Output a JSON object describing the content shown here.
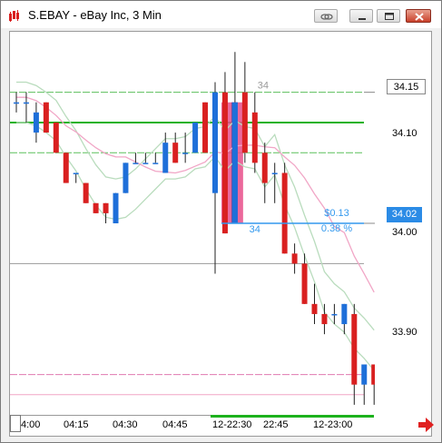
{
  "window": {
    "title": "S.EBAY - eBay Inc, 3 Min"
  },
  "toolbar": {
    "link_icon": "link-icon",
    "minimize_icon": "minimize-icon",
    "maximize_icon": "maximize-icon",
    "close_icon": "close-icon"
  },
  "colors": {
    "up_candle": "#1e6fd9",
    "down_candle": "#d92020",
    "green_line": "#1db21d",
    "ma_green": "#b9dcbd",
    "ma_pink": "#f1a6c6",
    "measure_blue": "#3399ee",
    "highlight_pink": "#e84e8a",
    "highlight_purple": "#6a4c9c"
  },
  "price_axis": {
    "labels": [
      "34.10",
      "34.00",
      "33.90"
    ],
    "current_price_label": "34.15",
    "measure_price_label": "34.02"
  },
  "time_axis": {
    "labels": [
      "4:00",
      "04:15",
      "04:30",
      "04:45",
      "12-22:30",
      "22:45",
      "12-23:00"
    ]
  },
  "measurement": {
    "amount": "$0.13",
    "percent": "0.38 %",
    "bars_top": "34",
    "bars_bottom": "34"
  },
  "chart_data": {
    "type": "candlestick",
    "symbol": "S.EBAY",
    "interval": "3 Min",
    "ylim": [
      33.83,
      34.21
    ],
    "candles": [
      {
        "o": 34.14,
        "h": 34.15,
        "l": 34.13,
        "c": 34.14
      },
      {
        "o": 34.14,
        "h": 34.15,
        "l": 34.12,
        "c": 34.14
      },
      {
        "o": 34.11,
        "h": 34.14,
        "l": 34.1,
        "c": 34.13
      },
      {
        "o": 34.14,
        "h": 34.14,
        "l": 34.11,
        "c": 34.11
      },
      {
        "o": 34.12,
        "h": 34.12,
        "l": 34.09,
        "c": 34.09
      },
      {
        "o": 34.09,
        "h": 34.09,
        "l": 34.06,
        "c": 34.06
      },
      {
        "o": 34.07,
        "h": 34.07,
        "l": 34.06,
        "c": 34.07
      },
      {
        "o": 34.06,
        "h": 34.06,
        "l": 34.04,
        "c": 34.04
      },
      {
        "o": 34.04,
        "h": 34.04,
        "l": 34.03,
        "c": 34.03
      },
      {
        "o": 34.04,
        "h": 34.04,
        "l": 34.02,
        "c": 34.03
      },
      {
        "o": 34.02,
        "h": 34.05,
        "l": 34.02,
        "c": 34.05
      },
      {
        "o": 34.05,
        "h": 34.08,
        "l": 34.05,
        "c": 34.08
      },
      {
        "o": 34.08,
        "h": 34.09,
        "l": 34.08,
        "c": 34.08
      },
      {
        "o": 34.08,
        "h": 34.09,
        "l": 34.08,
        "c": 34.08
      },
      {
        "o": 34.08,
        "h": 34.09,
        "l": 34.08,
        "c": 34.08
      },
      {
        "o": 34.07,
        "h": 34.11,
        "l": 34.07,
        "c": 34.1
      },
      {
        "o": 34.1,
        "h": 34.11,
        "l": 34.08,
        "c": 34.08
      },
      {
        "o": 34.09,
        "h": 34.11,
        "l": 34.08,
        "c": 34.09
      },
      {
        "o": 34.09,
        "h": 34.12,
        "l": 34.09,
        "c": 34.12
      },
      {
        "o": 34.14,
        "h": 34.14,
        "l": 34.09,
        "c": 34.09
      },
      {
        "o": 34.05,
        "h": 34.16,
        "l": 33.97,
        "c": 34.15
      },
      {
        "o": 34.15,
        "h": 34.17,
        "l": 34.01,
        "c": 34.01
      },
      {
        "o": 34.02,
        "h": 34.19,
        "l": 34.02,
        "c": 34.14
      },
      {
        "o": 34.15,
        "h": 34.18,
        "l": 34.08,
        "c": 34.09
      },
      {
        "o": 34.13,
        "h": 34.15,
        "l": 34.07,
        "c": 34.08
      },
      {
        "o": 34.09,
        "h": 34.1,
        "l": 34.04,
        "c": 34.06
      },
      {
        "o": 34.07,
        "h": 34.08,
        "l": 34.04,
        "c": 34.07
      },
      {
        "o": 34.07,
        "h": 34.08,
        "l": 33.99,
        "c": 33.99
      },
      {
        "o": 33.99,
        "h": 34.0,
        "l": 33.97,
        "c": 33.98
      },
      {
        "o": 33.98,
        "h": 33.99,
        "l": 33.94,
        "c": 33.94
      },
      {
        "o": 33.94,
        "h": 33.96,
        "l": 33.92,
        "c": 33.93
      },
      {
        "o": 33.93,
        "h": 33.94,
        "l": 33.91,
        "c": 33.92
      },
      {
        "o": 33.93,
        "h": 33.94,
        "l": 33.92,
        "c": 33.93
      },
      {
        "o": 33.92,
        "h": 33.94,
        "l": 33.91,
        "c": 33.94
      },
      {
        "o": 33.93,
        "h": 33.94,
        "l": 33.84,
        "c": 33.86
      },
      {
        "o": 33.86,
        "h": 33.88,
        "l": 33.84,
        "c": 33.88
      },
      {
        "o": 33.88,
        "h": 33.88,
        "l": 33.84,
        "c": 33.86
      }
    ],
    "horizontal_lines": [
      {
        "price": 34.15,
        "color": "#5cbf5c",
        "style": "dashed"
      },
      {
        "price": 34.12,
        "color": "#1db21d",
        "style": "solid"
      },
      {
        "price": 34.09,
        "color": "#5cbf5c",
        "style": "dashed"
      },
      {
        "price": 33.98,
        "color": "#999999",
        "style": "solid"
      },
      {
        "price": 33.87,
        "color": "#e07ab0",
        "style": "dashed"
      },
      {
        "price": 33.85,
        "color": "#f1a6c6",
        "style": "solid"
      }
    ],
    "price_markers": [
      34.15,
      34.02
    ]
  }
}
